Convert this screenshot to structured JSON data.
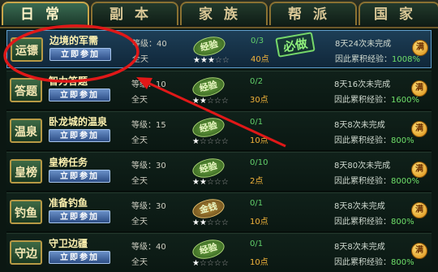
{
  "tabs": [
    {
      "label": "日常",
      "active": true
    },
    {
      "label": "副本",
      "active": false
    },
    {
      "label": "家族",
      "active": false
    },
    {
      "label": "帮派",
      "active": false
    },
    {
      "label": "国家",
      "active": false
    }
  ],
  "join_label": "立即参加",
  "must_label": "必做",
  "coin_label": "满",
  "colors": {
    "highlight_circle": "#e01818",
    "arrow": "#e01818",
    "selected_row_border": "#5e9fce"
  },
  "rows": [
    {
      "category": "运镖",
      "name": "边境的军需",
      "level": "等级：40",
      "time": "全天",
      "reward": "经验",
      "reward_icon": "green-seal",
      "stars_on": 3,
      "stars_total": 5,
      "progress": "0/3",
      "points": "40点",
      "must": true,
      "status": "8天24次未完成",
      "bonus_prefix": "因此累积经验：",
      "bonus_pct": "1008%",
      "selected": true
    },
    {
      "category": "答题",
      "name": "智力答题",
      "level": "等级：10",
      "time": "全天",
      "reward": "经验",
      "reward_icon": "green-seal",
      "stars_on": 2,
      "stars_total": 5,
      "progress": "0/2",
      "points": "30点",
      "must": false,
      "status": "8天16次未完成",
      "bonus_prefix": "因此累积经验：",
      "bonus_pct": "1600%",
      "selected": false
    },
    {
      "category": "温泉",
      "name": "卧龙城的温泉",
      "level": "等级：15",
      "time": "全天",
      "reward": "经验",
      "reward_icon": "green-seal",
      "stars_on": 1,
      "stars_total": 5,
      "progress": "0/1",
      "points": "10点",
      "must": false,
      "status": "8天8次未完成",
      "bonus_prefix": "因此累积经验：",
      "bonus_pct": "800%",
      "selected": false
    },
    {
      "category": "皇榜",
      "name": "皇榜任务",
      "level": "等级：30",
      "time": "全天",
      "reward": "经验",
      "reward_icon": "green-seal",
      "stars_on": 2,
      "stars_total": 5,
      "progress": "0/10",
      "points": "2点",
      "must": false,
      "status": "8天80次未完成",
      "bonus_prefix": "因此累积经验：",
      "bonus_pct": "8000%",
      "selected": false
    },
    {
      "category": "钓鱼",
      "name": "准备钓鱼",
      "level": "等级：30",
      "time": "全天",
      "reward": "金钱",
      "reward_icon": "gold-seal",
      "stars_on": 2,
      "stars_total": 5,
      "progress": "0/1",
      "points": "10点",
      "must": false,
      "status": "8天8次未完成",
      "bonus_prefix": "因此累积经验：",
      "bonus_pct": "800%",
      "selected": false
    },
    {
      "category": "守边",
      "name": "守卫边疆",
      "level": "等级：40",
      "time": "全天",
      "reward": "经验",
      "reward_icon": "green-seal",
      "stars_on": 1,
      "stars_total": 5,
      "progress": "0/1",
      "points": "10点",
      "must": false,
      "status": "8天8次未完成",
      "bonus_prefix": "因此累积经验：",
      "bonus_pct": "800%",
      "selected": false
    }
  ]
}
